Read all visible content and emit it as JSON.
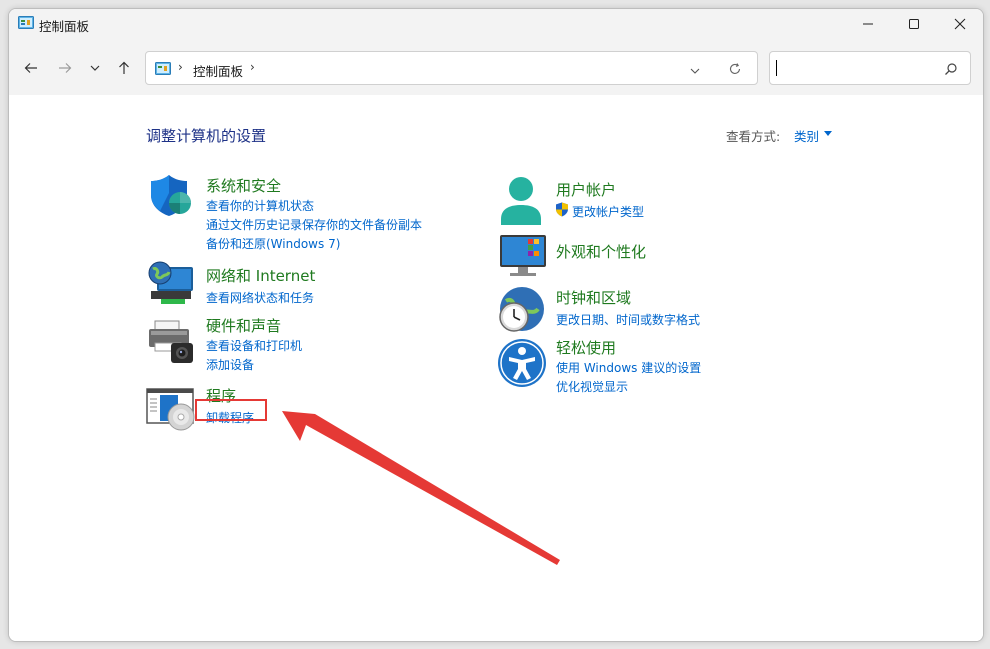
{
  "window": {
    "title": "控制面板"
  },
  "address": {
    "crumb": "控制面板"
  },
  "search": {
    "placeholder": "",
    "value": ""
  },
  "heading": "调整计算机的设置",
  "view_by": {
    "label": "查看方式:",
    "value": "类别"
  },
  "categories": [
    {
      "title": "系统和安全",
      "icon": "system-security-shield-icon",
      "links": [
        "查看你的计算机状态",
        "通过文件历史记录保存你的文件备份副本",
        "备份和还原(Windows 7)"
      ]
    },
    {
      "title": "网络和 Internet",
      "icon": "network-globe-icon",
      "links": [
        "查看网络状态和任务"
      ]
    },
    {
      "title": "硬件和声音",
      "icon": "printer-camera-icon",
      "links": [
        "查看设备和打印机",
        "添加设备"
      ]
    },
    {
      "title": "程序",
      "icon": "programs-disc-icon",
      "links": [
        "卸载程序"
      ]
    },
    {
      "title": "用户帐户",
      "icon": "user-accounts-icon",
      "links": [
        "更改帐户类型"
      ]
    },
    {
      "title": "外观和个性化",
      "icon": "appearance-monitor-icon",
      "links": []
    },
    {
      "title": "时钟和区域",
      "icon": "clock-globe-icon",
      "links": [
        "更改日期、时间或数字格式"
      ]
    },
    {
      "title": "轻松使用",
      "icon": "accessibility-icon",
      "links": [
        "使用 Windows 建议的设置",
        "优化视觉显示"
      ]
    }
  ],
  "colors": {
    "link": "#0066cc",
    "category_title": "#1f7a1f",
    "heading": "#1e3287",
    "annotation": "#e53935"
  }
}
